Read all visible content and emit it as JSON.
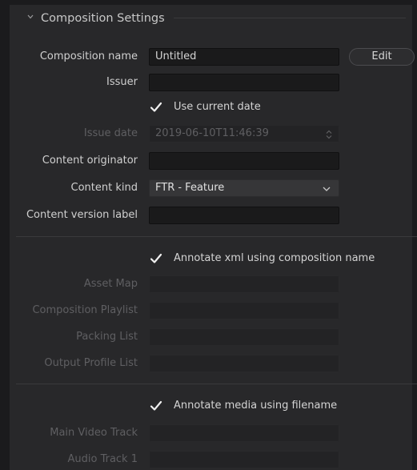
{
  "section": {
    "title": "Composition Settings"
  },
  "fields": {
    "composition_name": {
      "label": "Composition name",
      "value": "Untitled"
    },
    "issuer": {
      "label": "Issuer",
      "value": ""
    },
    "use_current_date": {
      "label": "Use current date",
      "checked": true
    },
    "issue_date": {
      "label": "Issue date",
      "value": "2019-06-10T11:46:39"
    },
    "content_originator": {
      "label": "Content originator",
      "value": ""
    },
    "content_kind": {
      "label": "Content kind",
      "value": "FTR - Feature"
    },
    "content_version_label": {
      "label": "Content version label",
      "value": ""
    }
  },
  "buttons": {
    "edit": "Edit"
  },
  "annotate_xml": {
    "label": "Annotate xml using composition name",
    "checked": true,
    "asset_map": {
      "label": "Asset Map",
      "value": ""
    },
    "composition_playlist": {
      "label": "Composition Playlist",
      "value": ""
    },
    "packing_list": {
      "label": "Packing List",
      "value": ""
    },
    "output_profile_list": {
      "label": "Output Profile List",
      "value": ""
    }
  },
  "annotate_media": {
    "label": "Annotate media using filename",
    "checked": true,
    "main_video_track": {
      "label": "Main Video Track",
      "value": ""
    },
    "audio_track_1": {
      "label": "Audio Track 1",
      "value": ""
    }
  }
}
